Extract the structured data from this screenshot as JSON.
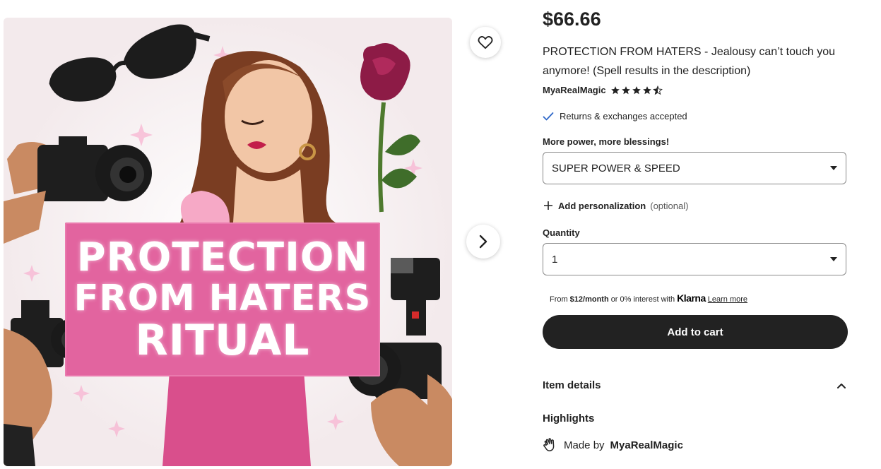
{
  "image": {
    "banner_lines": [
      "PROTECTION",
      "FROM HATERS",
      "RITUAL"
    ],
    "accent_pink": "#e2649f",
    "dress_pink": "#d94f8c"
  },
  "listing": {
    "price": "$66.66",
    "title": "PROTECTION FROM HATERS - Jealousy can’t touch you anymore! (Spell results in the description)",
    "shop_name": "MyaRealMagic",
    "rating": 4.5,
    "returns_text": "Returns & exchanges accepted"
  },
  "options": {
    "label": "More power, more blessings!",
    "selected": "SUPER POWER & SPEED"
  },
  "personalization": {
    "label": "Add personalization",
    "optional": "(optional)"
  },
  "quantity": {
    "label": "Quantity",
    "value": "1"
  },
  "klarna": {
    "prefix": "From",
    "amount": "$12/month",
    "middle": "or 0% interest with",
    "brand": "Klarna",
    "link": "Learn more"
  },
  "cart": {
    "label": "Add to cart"
  },
  "details": {
    "item_details": "Item details",
    "highlights": "Highlights",
    "made_by_prefix": "Made by",
    "made_by_shop": "MyaRealMagic"
  },
  "colors": {
    "button_dark": "#222222",
    "check_blue": "#2e67c8"
  }
}
